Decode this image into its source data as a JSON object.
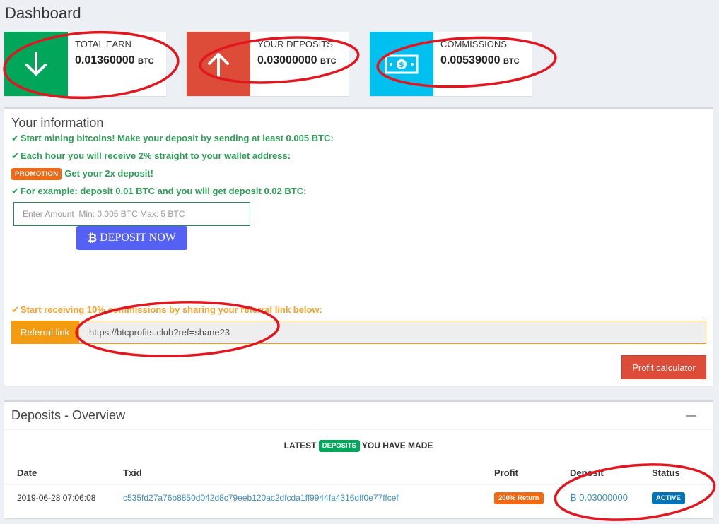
{
  "page_title": "Dashboard",
  "info_boxes": [
    {
      "label": "TOTAL EARN",
      "value": "0.01360000",
      "unit": "BTC",
      "color": "#00a65a",
      "icon": "arrow-down-icon"
    },
    {
      "label": "YOUR DEPOSITS",
      "value": "0.03000000",
      "unit": "BTC",
      "color": "#dd4b39",
      "icon": "arrow-up-icon"
    },
    {
      "label": "COMMISSIONS",
      "value": "0.00539000",
      "unit": "BTC",
      "color": "#00c0ef",
      "icon": "money-bill-icon"
    }
  ],
  "info_panel": {
    "title": "Your information",
    "line1": "Start mining bitcoins! Make your deposit by sending at least 0.005 BTC:",
    "line2": "Each hour you will receive 2% straight to your wallet address:",
    "promo_badge": "PROMOTION",
    "promo_text": "Get your 2x deposit!",
    "line4": "For example: deposit 0.01 BTC and you will get deposit 0.02 BTC:",
    "amount_placeholder": "Enter Amount  Min: 0.005 BTC Max: 5 BTC",
    "deposit_button": "DEPOSIT NOW",
    "referral_line": "Start receiving 10% commissions by sharing your referral link below:",
    "referral_label": "Referral link",
    "referral_value": "https://btcprofits.club?ref=shane23",
    "profit_button": "Profit calculator"
  },
  "deposits_panel": {
    "title": "Deposits - Overview",
    "latest_prefix": "LATEST",
    "latest_badge": "DEPOSITS",
    "latest_suffix": "YOU HAVE MADE",
    "columns": {
      "date": "Date",
      "txid": "Txid",
      "profit": "Profit",
      "deposit": "Deposit",
      "status": "Status"
    },
    "rows": [
      {
        "date": "2019-06-28 07:06:08",
        "txid": "c535fd27a76b8850d042d8c79eeb120ac2dfcda1ff9944fa4316dff0e77ffcef",
        "profit": "200% Return",
        "deposit": "0.03000000",
        "status": "ACTIVE"
      }
    ]
  },
  "colors": {
    "annotation": "#e1161e"
  }
}
